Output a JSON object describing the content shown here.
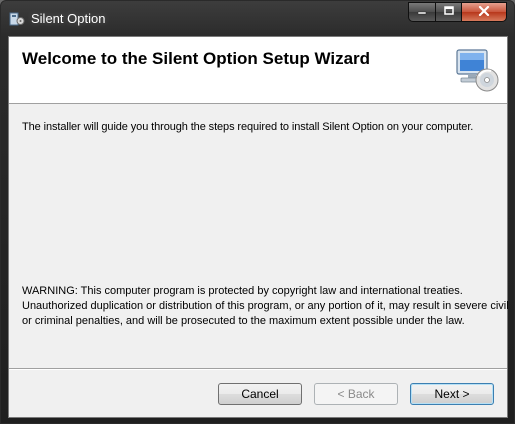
{
  "window": {
    "title": "Silent Option"
  },
  "caption_buttons": {
    "minimize_icon": "minimize-icon",
    "maximize_icon": "maximize-icon",
    "close_icon": "close-icon"
  },
  "banner": {
    "title": "Welcome to the Silent Option Setup Wizard",
    "icon": "computer-cd-icon"
  },
  "body": {
    "intro": "The installer will guide you through the steps required to install Silent Option on your computer.",
    "warning_lines": [
      "WARNING: This computer program is protected by copyright law and international treaties.",
      "Unauthorized duplication or distribution of this program, or any portion of it, may result in severe civil",
      "or criminal penalties, and will be prosecuted to the maximum extent possible under the law."
    ]
  },
  "buttons": {
    "cancel": "Cancel",
    "back": "< Back",
    "next": "Next >"
  },
  "colors": {
    "title_bar": "#2b2b2b",
    "client_bg": "#f0f0f0",
    "banner_bg": "#ffffff",
    "close_button": "#c9553b",
    "default_button_border": "#3c7fb1"
  }
}
